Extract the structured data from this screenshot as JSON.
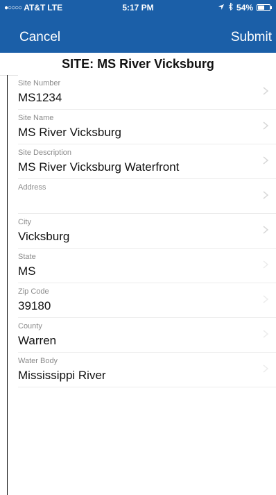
{
  "status_bar": {
    "carrier": "AT&T",
    "network": "LTE",
    "time": "5:17 PM",
    "battery": "54%",
    "battery_level": 0.54
  },
  "nav": {
    "cancel_label": "Cancel",
    "submit_label": "Submit"
  },
  "header": {
    "title": "SITE: MS River Vicksburg"
  },
  "fields": [
    {
      "label": "Site Number",
      "value": "MS1234"
    },
    {
      "label": "Site Name",
      "value": "MS River Vicksburg"
    },
    {
      "label": "Site Description",
      "value": "MS River Vicksburg Waterfront"
    },
    {
      "label": "Address",
      "value": ""
    },
    {
      "label": "City",
      "value": "Vicksburg"
    },
    {
      "label": "State",
      "value": "MS"
    },
    {
      "label": "Zip Code",
      "value": "39180"
    },
    {
      "label": "County",
      "value": "Warren"
    },
    {
      "label": "Water Body",
      "value": "Mississippi River"
    }
  ],
  "colors": {
    "nav_background": "#1b5fa8",
    "text": "#111111",
    "label": "#8a8a8a"
  }
}
